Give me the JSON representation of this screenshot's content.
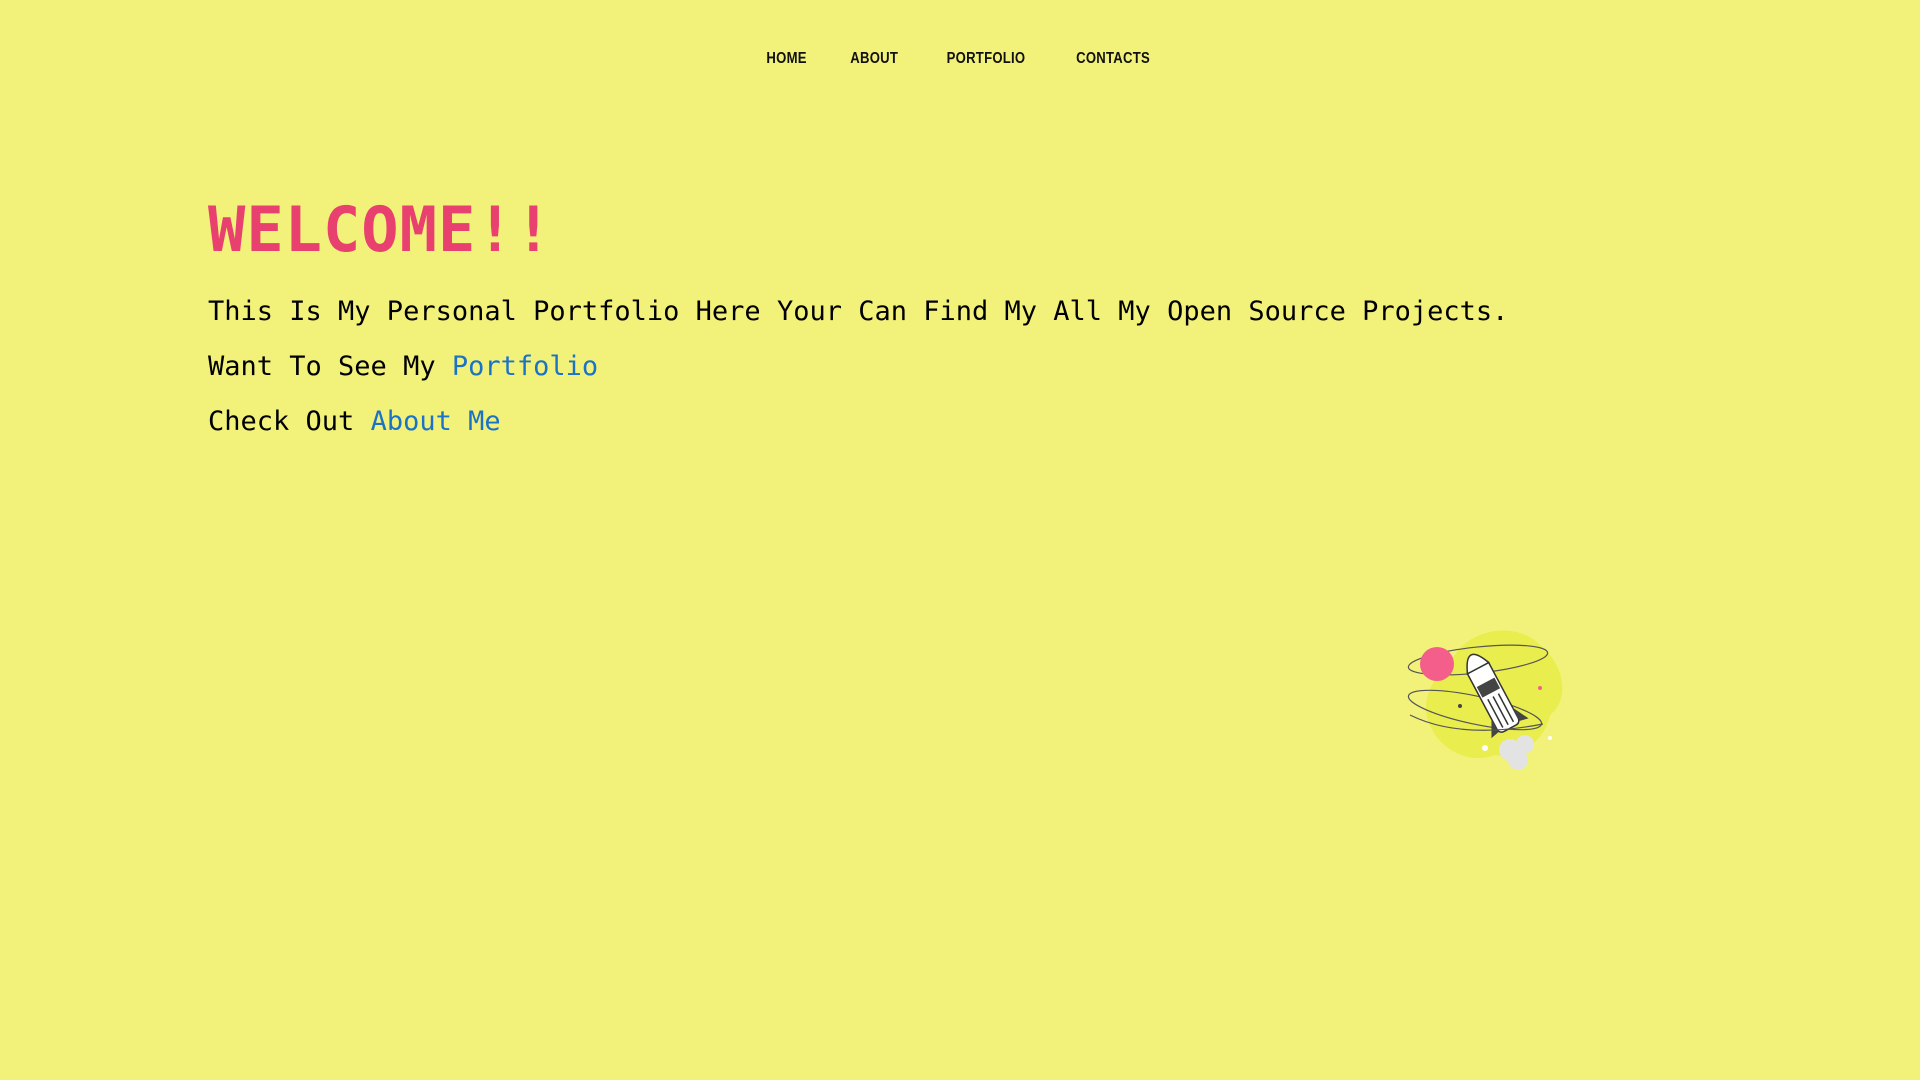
{
  "nav": {
    "items": [
      {
        "label": "HOME"
      },
      {
        "label": "ABOUT"
      },
      {
        "label": "PORTFOLIO"
      },
      {
        "label": "CONTACTS"
      }
    ]
  },
  "hero": {
    "title": "WELCOME!!",
    "intro": "This Is My Personal Portfolio Here Your Can Find My All My Open Source Projects.",
    "portfolio_prefix": "Want To See My ",
    "portfolio_link": "Portfolio",
    "about_prefix": "Check Out ",
    "about_link": "About Me"
  },
  "colors": {
    "background": "#f2f27a",
    "title": "#e8416f",
    "link": "#1a73c7",
    "text": "#000000"
  },
  "illustration": {
    "icon": "rocket-planet-icon"
  }
}
